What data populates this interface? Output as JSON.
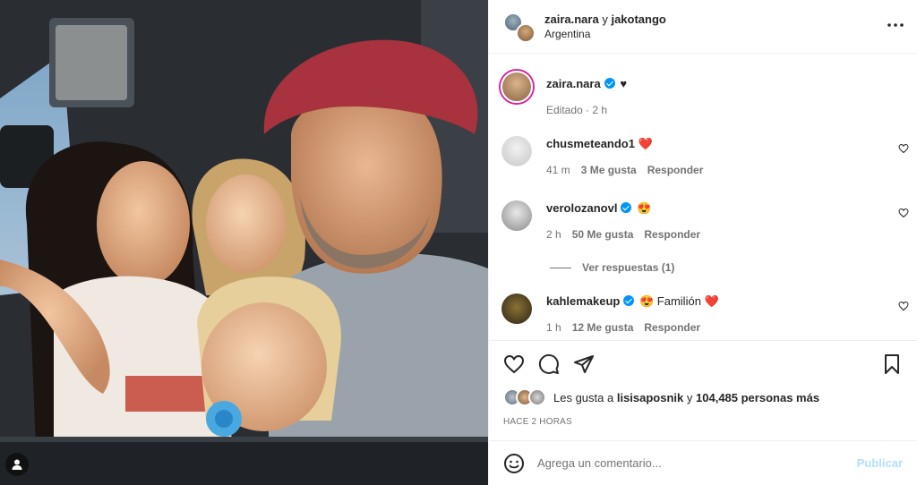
{
  "header": {
    "user1": "zaira.nara",
    "joiner": "y",
    "user2": "jakotango",
    "location": "Argentina"
  },
  "caption": {
    "username": "zaira.nara",
    "text": "♥",
    "meta": "Editado · 2 h"
  },
  "comments": [
    {
      "username": "chusmeteando1",
      "text": "❤️",
      "time": "41 m",
      "likes": "3 Me gusta",
      "reply": "Responder"
    },
    {
      "username": "verolozanovl",
      "text": "😍",
      "time": "2 h",
      "likes": "50 Me gusta",
      "reply": "Responder"
    },
    {
      "username": "kahlemakeup",
      "text": "😍 Familión ❤️",
      "time": "1 h",
      "likes": "12 Me gusta",
      "reply": "Responder"
    }
  ],
  "view_replies": "Ver respuestas (1)",
  "likes_line": {
    "prefix": "Les gusta a",
    "user": "lisisaposnik",
    "joiner": "y",
    "count": "104,485 personas más"
  },
  "time_ago": "HACE 2 HORAS",
  "add_comment": {
    "placeholder": "Agrega un comentario...",
    "publish": "Publicar"
  },
  "icons": {
    "more": "more-icon",
    "like": "heart-icon",
    "comment": "comment-icon",
    "share": "share-icon",
    "save": "bookmark-icon",
    "emoji": "emoji-icon",
    "tag": "user-tag-icon"
  }
}
